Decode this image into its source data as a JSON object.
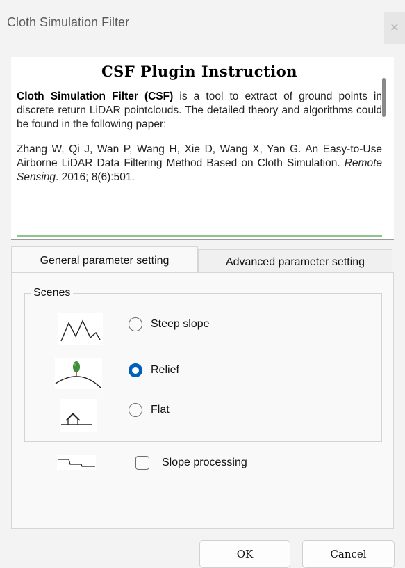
{
  "window": {
    "title": "Cloth Simulation Filter",
    "close_glyph": "✕"
  },
  "instruction": {
    "heading": "CSF Plugin Instruction",
    "intro_bold": "Cloth Simulation Filter (CSF)",
    "intro_rest": " is a tool to extract of ground points in discrete return LiDAR pointclouds. The detailed theory and algorithms could be found in the following paper:",
    "ref_authors": "Zhang W, Qi J, Wan P, Wang H, Xie D, Wang X, Yan G. An Easy-to-Use Airborne LiDAR Data Filtering Method Based on Cloth Simulation. ",
    "ref_journal": "Remote Sensing",
    "ref_tail": ". 2016; 8(6):501."
  },
  "tabs": [
    {
      "label": "General parameter setting",
      "active": true
    },
    {
      "label": "Advanced parameter setting",
      "active": false
    }
  ],
  "scenes": {
    "group_label": "Scenes",
    "options": [
      {
        "label": "Steep slope",
        "checked": false,
        "icon": "steep-slope-icon"
      },
      {
        "label": "Relief",
        "checked": true,
        "icon": "relief-icon"
      },
      {
        "label": "Flat",
        "checked": false,
        "icon": "flat-icon"
      }
    ]
  },
  "slope_processing": {
    "label": "Slope processing",
    "checked": false,
    "icon": "step-icon"
  },
  "buttons": {
    "ok": "OK",
    "cancel": "Cancel"
  },
  "colors": {
    "accent": "#005fb8",
    "rule_green": "#8fc58c"
  }
}
